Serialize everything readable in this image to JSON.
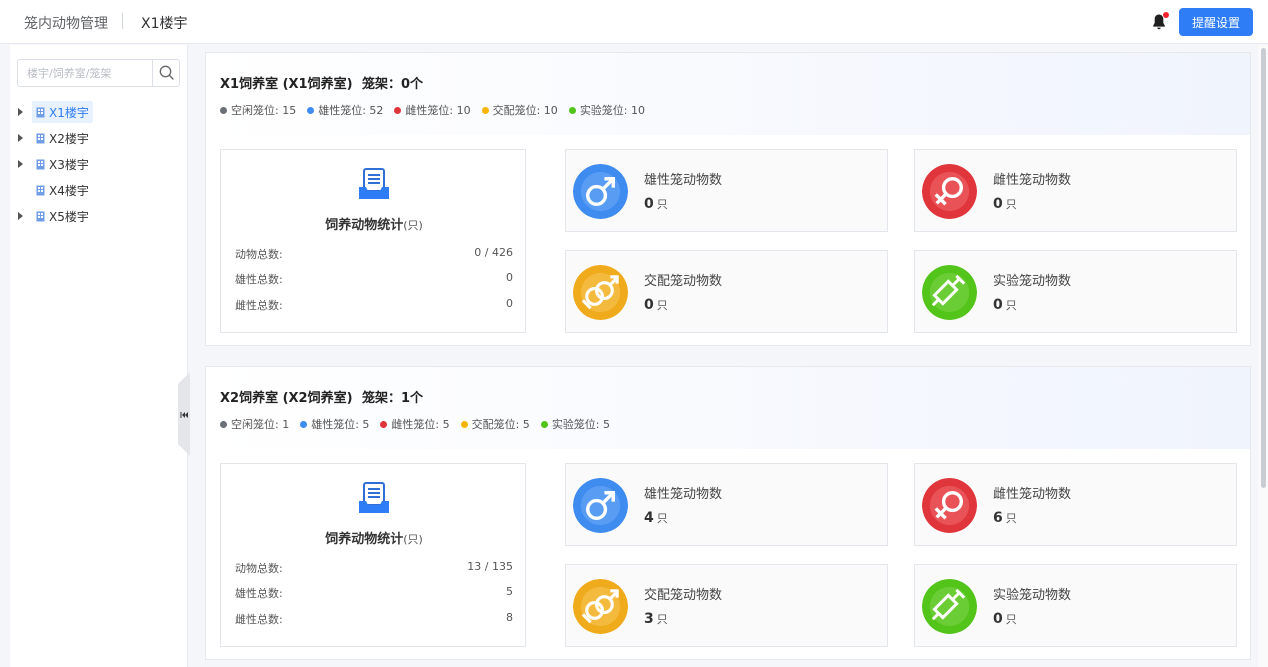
{
  "header": {
    "module_title": "笼内动物管理",
    "current_building": "X1楼宇",
    "remind_button": "提醒设置"
  },
  "sidebar": {
    "search_placeholder": "楼宇/饲养室/笼架",
    "tree": [
      {
        "label": "X1楼宇",
        "expandable": true,
        "active": true
      },
      {
        "label": "X2楼宇",
        "expandable": true,
        "active": false
      },
      {
        "label": "X3楼宇",
        "expandable": true,
        "active": false
      },
      {
        "label": "X4楼宇",
        "expandable": false,
        "active": false
      },
      {
        "label": "X5楼宇",
        "expandable": true,
        "active": false
      }
    ]
  },
  "colors": {
    "accent": "#2f7df6",
    "idle": "#6b6f76",
    "male": "#3f8cf0",
    "female": "#e0353a",
    "mating": "#f5b500",
    "experiment": "#52c41a"
  },
  "rooms": [
    {
      "title": "X1饲养室 (X1饲养室)",
      "rack": "笼架：0个",
      "legend": [
        {
          "label": "空闲笼位: 15",
          "color": "#6b6f76"
        },
        {
          "label": "雄性笼位: 52",
          "color": "#3f8cf0"
        },
        {
          "label": "雌性笼位: 10",
          "color": "#e0353a"
        },
        {
          "label": "交配笼位: 10",
          "color": "#f5b500"
        },
        {
          "label": "实验笼位: 10",
          "color": "#52c41a"
        }
      ],
      "stats": {
        "title": "饲养动物统计",
        "unit": "(只)",
        "rows": [
          {
            "key": "动物总数:",
            "value": "0 / 426"
          },
          {
            "key": "雄性总数:",
            "value": "0"
          },
          {
            "key": "雌性总数:",
            "value": "0"
          }
        ]
      },
      "cards": [
        {
          "label": "雄性笼动物数",
          "value": "0",
          "unit": "只",
          "icon": "male-symbol-icon"
        },
        {
          "label": "雌性笼动物数",
          "value": "0",
          "unit": "只",
          "icon": "female-symbol-icon"
        },
        {
          "label": "交配笼动物数",
          "value": "0",
          "unit": "只",
          "icon": "mating-symbol-icon"
        },
        {
          "label": "实验笼动物数",
          "value": "0",
          "unit": "只",
          "icon": "syringe-icon"
        }
      ]
    },
    {
      "title": "X2饲养室 (X2饲养室)",
      "rack": "笼架：1个",
      "legend": [
        {
          "label": "空闲笼位: 1",
          "color": "#6b6f76"
        },
        {
          "label": "雄性笼位: 5",
          "color": "#3f8cf0"
        },
        {
          "label": "雌性笼位: 5",
          "color": "#e0353a"
        },
        {
          "label": "交配笼位: 5",
          "color": "#f5b500"
        },
        {
          "label": "实验笼位: 5",
          "color": "#52c41a"
        }
      ],
      "stats": {
        "title": "饲养动物统计",
        "unit": "(只)",
        "rows": [
          {
            "key": "动物总数:",
            "value": "13 / 135"
          },
          {
            "key": "雄性总数:",
            "value": "5"
          },
          {
            "key": "雌性总数:",
            "value": "8"
          }
        ]
      },
      "cards": [
        {
          "label": "雄性笼动物数",
          "value": "4",
          "unit": "只",
          "icon": "male-symbol-icon"
        },
        {
          "label": "雌性笼动物数",
          "value": "6",
          "unit": "只",
          "icon": "female-symbol-icon"
        },
        {
          "label": "交配笼动物数",
          "value": "3",
          "unit": "只",
          "icon": "mating-symbol-icon"
        },
        {
          "label": "实验笼动物数",
          "value": "0",
          "unit": "只",
          "icon": "syringe-icon"
        }
      ]
    }
  ]
}
